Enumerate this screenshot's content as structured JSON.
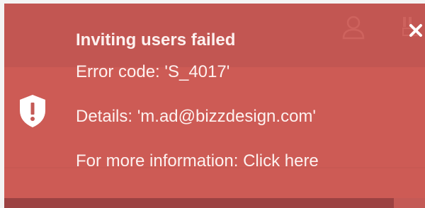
{
  "toast": {
    "title": "Inviting users failed",
    "error_code": "Error code: 'S_4017'",
    "details": "Details: 'm.ad@bizzdesign.com'",
    "more_prefix": "For more information: ",
    "more_link": "Click here",
    "close_icon": "close-icon",
    "shield_icon": "shield-exclamation-icon"
  },
  "background": {
    "user_icon": "user-icon",
    "app_icon": "app-icon"
  },
  "colors": {
    "toast_bg": "#c45a56",
    "header_bg": "#a94c4c",
    "text": "#fdf1ef"
  }
}
